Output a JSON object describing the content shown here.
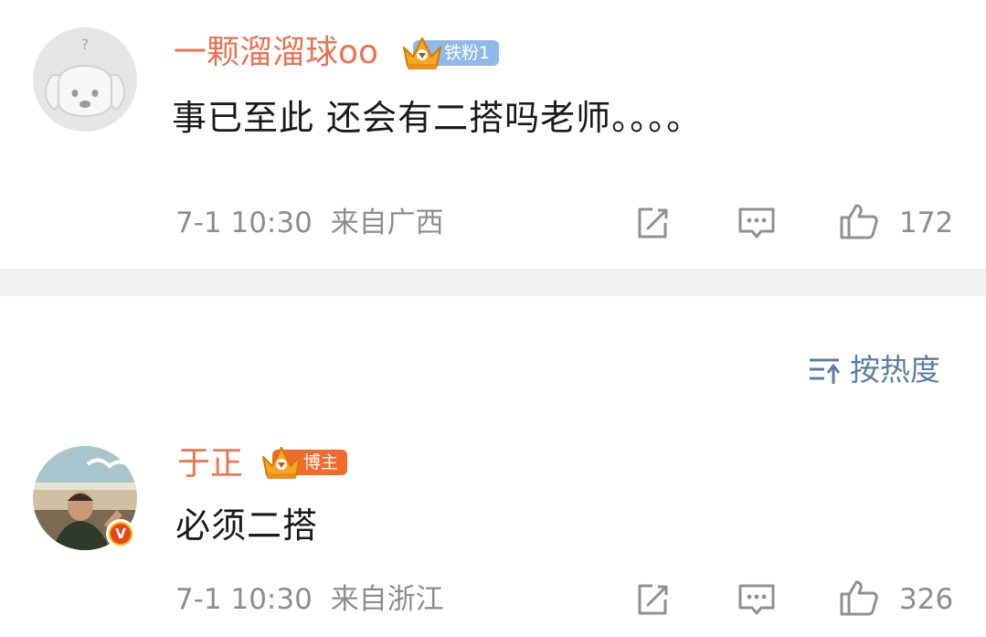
{
  "colors": {
    "username": "#eb7350",
    "fan_badge": "#8fb9e8",
    "blogger_badge": "#f06a2c",
    "meta_text": "#8d8d8d",
    "sort_text": "#5b7ea1",
    "divider": "#f1f1f1"
  },
  "comments": [
    {
      "username": "一颗溜溜球oo",
      "badge_label": "铁粉1",
      "badge_icon": "crown-icon",
      "text": "事已至此 还会有二搭吗老师。。。。",
      "time": "7-1 10:30",
      "location": "来自广西",
      "likes": "172",
      "avatar_icon": "default-dog-avatar-icon"
    },
    {
      "username": "于正",
      "badge_label": "博主",
      "badge_icon": "crown-icon",
      "verified_icon": "verified-v-icon",
      "verified_label": "V",
      "text": "必须二搭",
      "time": "7-1 10:30",
      "location": "来自浙江",
      "likes": "326",
      "avatar_icon": "user-photo-avatar"
    }
  ],
  "sort": {
    "label": "按热度",
    "icon": "sort-icon"
  },
  "icons": {
    "share": "share-icon",
    "comment": "comment-icon",
    "like": "thumbs-up-icon"
  }
}
